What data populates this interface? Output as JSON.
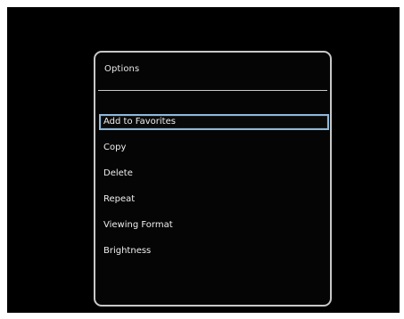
{
  "dialog": {
    "title": "Options",
    "items": [
      {
        "label": "Add to Favorites",
        "selected": true
      },
      {
        "label": "Copy",
        "selected": false
      },
      {
        "label": "Delete",
        "selected": false
      },
      {
        "label": "Repeat",
        "selected": false
      },
      {
        "label": "Viewing Format",
        "selected": false
      },
      {
        "label": "Brightness",
        "selected": false
      }
    ]
  },
  "colors": {
    "screen_background": "#000000",
    "panel_border": "#c8c8c8",
    "text": "#efefef",
    "selection_border": "#8fb8d9"
  }
}
